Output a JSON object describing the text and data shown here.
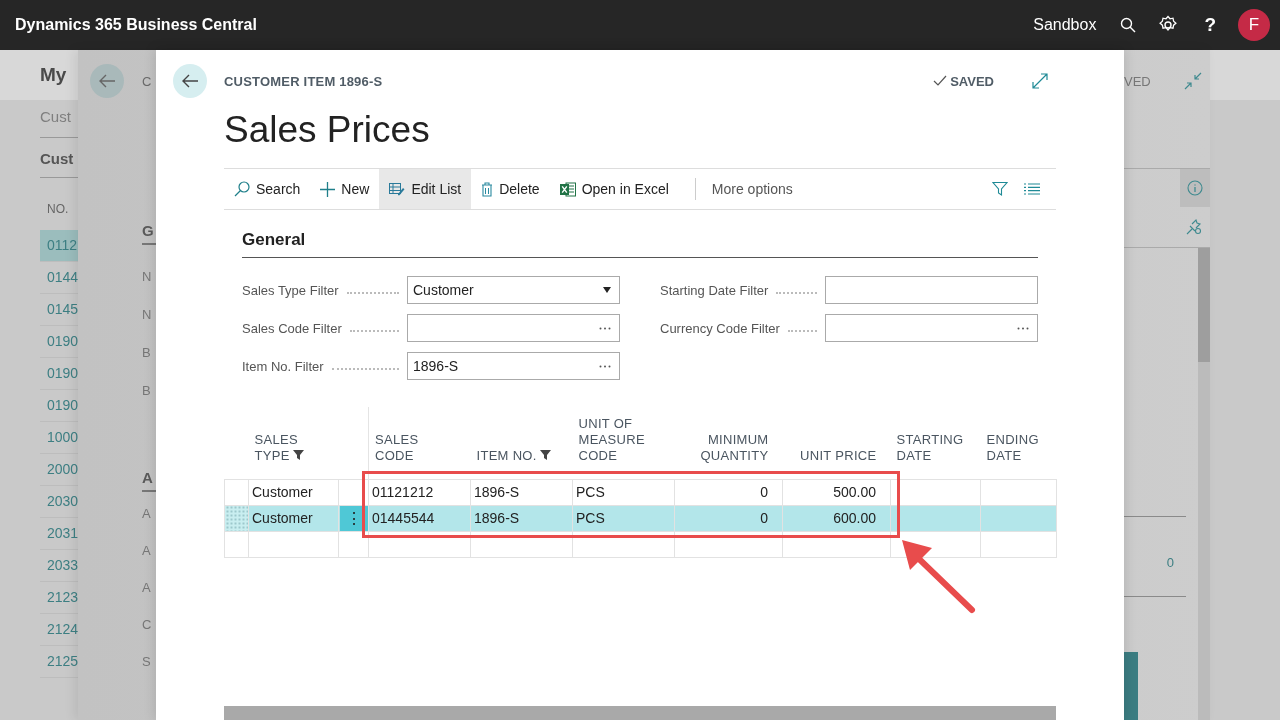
{
  "top_bar": {
    "title": "Dynamics 365 Business Central",
    "environment": "Sandbox",
    "help": "?",
    "avatar": "F"
  },
  "back_page": {
    "title": "My",
    "subtitle": "Cust",
    "tab": "Cust",
    "column": "NO.",
    "rows": [
      {
        "no": "0112",
        "selected": true
      },
      {
        "no": "0144",
        "selected": false
      },
      {
        "no": "0145",
        "selected": false
      },
      {
        "no": "0190",
        "selected": false
      },
      {
        "no": "0190",
        "selected": false
      },
      {
        "no": "0190",
        "selected": false
      },
      {
        "no": "1000",
        "selected": false
      },
      {
        "no": "2000",
        "selected": false
      },
      {
        "no": "2030",
        "selected": false
      },
      {
        "no": "2031",
        "selected": false
      },
      {
        "no": "2033",
        "selected": false
      },
      {
        "no": "2123",
        "selected": false
      },
      {
        "no": "2124",
        "selected": false
      },
      {
        "no": "2125",
        "selected": false
      }
    ]
  },
  "middle_page": {
    "breadcrumb": "C",
    "section_1": "G",
    "fields_1": [
      "N",
      "N",
      "B",
      "B"
    ],
    "section_2": "A",
    "fields_2": [
      "A",
      "A",
      "A",
      "C",
      "S"
    ],
    "status": "VED",
    "value": "0"
  },
  "dialog": {
    "breadcrumb": "CUSTOMER ITEM 1896-S",
    "status": "SAVED",
    "title": "Sales Prices",
    "actions": [
      {
        "kind": "search",
        "label": "Search",
        "selected": false
      },
      {
        "kind": "new",
        "label": "New",
        "selected": false
      },
      {
        "kind": "edit",
        "label": "Edit List",
        "selected": true
      },
      {
        "kind": "delete",
        "label": "Delete",
        "selected": false
      },
      {
        "kind": "excel",
        "label": "Open in Excel",
        "selected": false
      },
      {
        "kind": "more",
        "label": "More options",
        "selected": false
      }
    ],
    "section": "General",
    "fields": [
      {
        "label": "Sales Type Filter",
        "kind": "dropdown",
        "value": "Customer"
      },
      {
        "label": "Starting Date Filter",
        "kind": "text"
      },
      {
        "label": "Sales Code Filter",
        "kind": "lookup"
      },
      {
        "label": "Currency Code Filter",
        "kind": "lookup"
      },
      {
        "label": "Item No. Filter",
        "kind": "lookup",
        "value": "1896-S"
      }
    ],
    "table": {
      "row_menu": "⋮",
      "columns": [
        {
          "lines": [
            "SALES",
            "TYPE"
          ],
          "filtered": true,
          "kind": "text"
        },
        {
          "lines": [
            "SALES",
            "CODE"
          ],
          "filtered": false,
          "kind": "text"
        },
        {
          "lines": [
            "ITEM NO."
          ],
          "filtered": true,
          "kind": "text"
        },
        {
          "lines": [
            "UNIT OF",
            "MEASURE",
            "CODE"
          ],
          "filtered": false,
          "kind": "text"
        },
        {
          "lines": [
            "MINIMUM",
            "QUANTITY"
          ],
          "filtered": false,
          "kind": "number"
        },
        {
          "lines": [
            "UNIT PRICE"
          ],
          "filtered": false,
          "kind": "number"
        },
        {
          "lines": [
            "STARTING",
            "DATE"
          ],
          "filtered": false,
          "kind": "text"
        },
        {
          "lines": [
            "ENDING",
            "DATE"
          ],
          "filtered": false,
          "kind": "text"
        }
      ],
      "rows": [
        {
          "selected": false,
          "cells": [
            "Customer",
            "01121212",
            "1896-S",
            "PCS",
            "0",
            "500.00"
          ]
        },
        {
          "selected": true,
          "cells": [
            "Customer",
            "01445544",
            "1896-S",
            "PCS",
            "0",
            "600.00"
          ]
        }
      ]
    }
  }
}
